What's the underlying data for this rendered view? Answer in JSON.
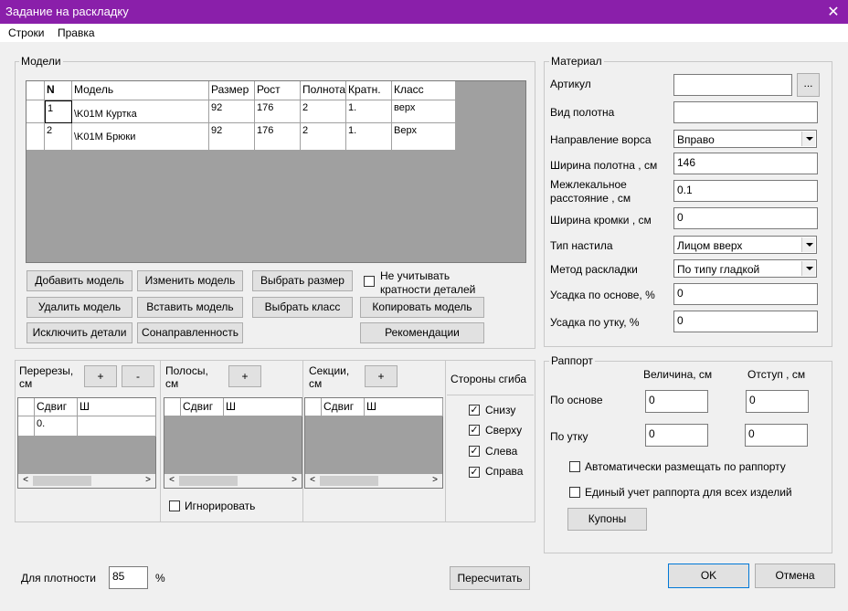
{
  "window": {
    "title": "Задание на раскладку",
    "close": "✕"
  },
  "menu": {
    "rows": "Строки",
    "edit": "Правка"
  },
  "models": {
    "group_label": "Модели",
    "headers": [
      "N",
      "Модель",
      "Размер",
      "Рост",
      "Полнота",
      "Кратн.",
      "Класс"
    ],
    "rows": [
      [
        "1",
        "\\K01M Куртка",
        "92",
        "176",
        "2",
        "1.",
        "верх"
      ],
      [
        "2",
        "\\K01M Брюки",
        "92",
        "176",
        "2",
        "1.",
        "Верх"
      ]
    ],
    "buttons": {
      "add": "Добавить модель",
      "change": "Изменить модель",
      "choose_size": "Выбрать размер",
      "delete": "Удалить модель",
      "insert": "Вставить модель",
      "choose_class": "Выбрать класс",
      "exclude": "Исключить детали",
      "codirection": "Сонаправленность",
      "copy": "Копировать модель",
      "recommend": "Рекомендации"
    },
    "ignore_label_1": "Не учитывать",
    "ignore_label_2": "кратности деталей"
  },
  "material": {
    "group_label": "Материал",
    "article_label": "Артикул",
    "article_value": "",
    "browse": "...",
    "fabric_label": "Вид полотна",
    "fabric_value": "",
    "nap_label": "Направление ворса",
    "nap_value": "Вправо",
    "width_label": "Ширина полотна , см",
    "width_value": "146",
    "gap_label_1": "Межлекальное",
    "gap_label_2": "расстояние , см",
    "gap_value": "0.1",
    "edge_label": "Ширина кромки , см",
    "edge_value": "0",
    "spread_label": "Тип настила",
    "spread_value": "Лицом вверх",
    "method_label": "Метод раскладки",
    "method_value": "По типу гладкой",
    "shrink_warp_label": "Усадка по основе, %",
    "shrink_warp_value": "0",
    "shrink_weft_label": "Усадка по утку, %",
    "shrink_weft_value": "0"
  },
  "cuts": {
    "label_1": "Перерезы,",
    "label_2": "см",
    "plus": "+",
    "minus": "-",
    "col1": "Сдвиг",
    "col2": "Ш",
    "value": "0."
  },
  "strips": {
    "label_1": "Полосы,",
    "label_2": "см",
    "plus": "+",
    "col1": "Сдвиг",
    "col2": "Ш",
    "ignore": "Игнорировать"
  },
  "sections": {
    "label_1": "Секции,",
    "label_2": "см",
    "plus": "+",
    "col1": "Сдвиг",
    "col2": "Ш"
  },
  "fold": {
    "label": "Стороны сгиба",
    "items": [
      "Снизу",
      "Сверху",
      "Слева",
      "Справа"
    ],
    "check": "✓"
  },
  "rapport": {
    "group_label": "Раппорт",
    "size_label": "Величина, см",
    "offset_label": "Отступ , см",
    "warp_label": "По основе",
    "warp_size": "0",
    "warp_offset": "0",
    "weft_label": "По утку",
    "weft_size": "0",
    "weft_offset": "0",
    "auto_label": "Автоматически размещать по раппорту",
    "single_label": "Единый учет раппорта для всех изделий",
    "coupons": "Купоны"
  },
  "density": {
    "label": "Для плотности",
    "value": "85",
    "unit": "%"
  },
  "footer": {
    "recalc": "Пересчитать",
    "ok": "OK",
    "cancel": "Отмена"
  },
  "scroll": {
    "left": "<",
    "right": ">"
  }
}
